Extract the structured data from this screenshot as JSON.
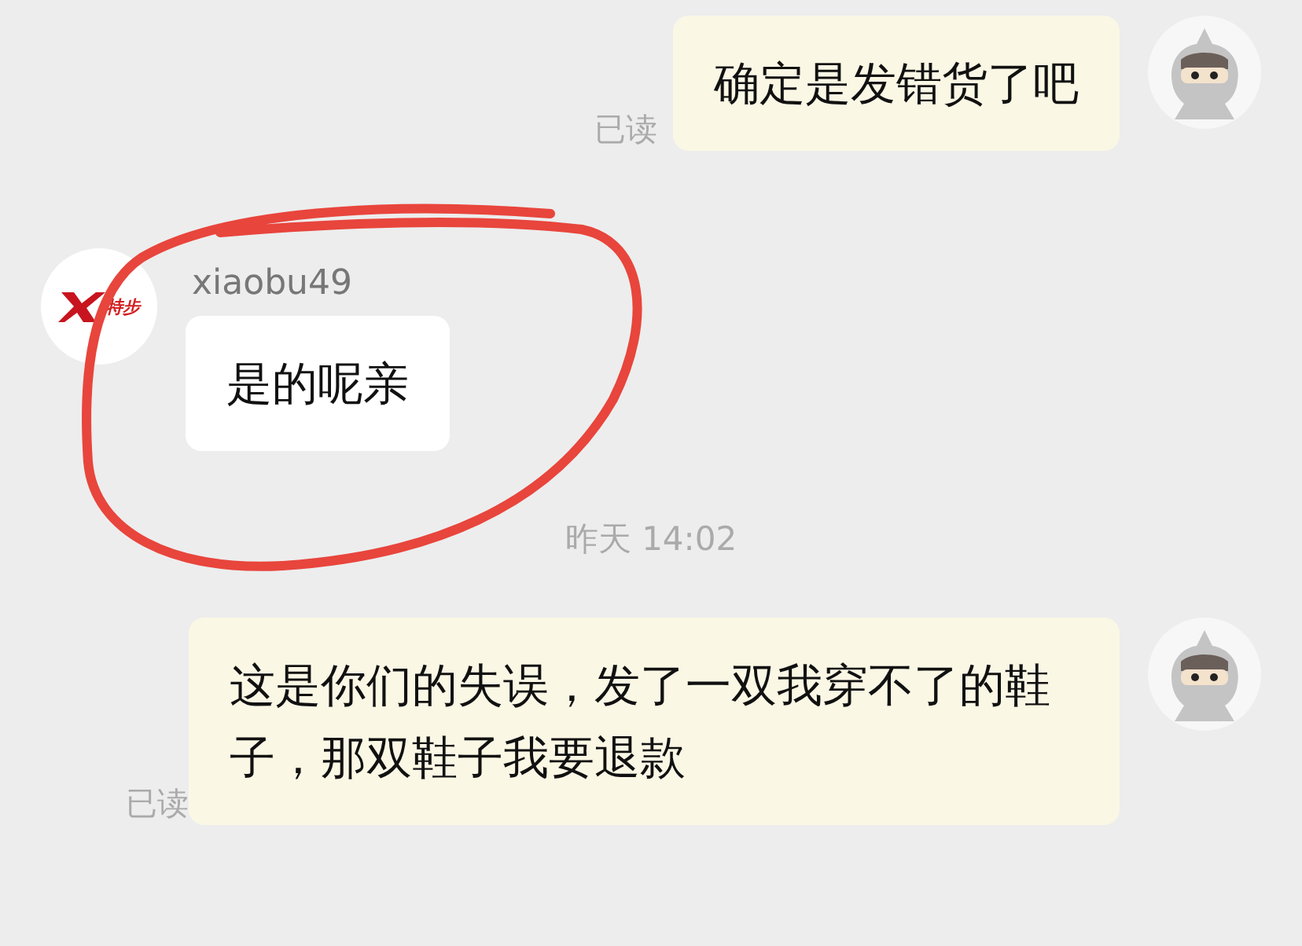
{
  "messages": [
    {
      "kind": "outgoing",
      "text": "确定是发错货了吧",
      "status": "已读"
    },
    {
      "kind": "incoming",
      "sender": "xiaobu49",
      "logo_text": "特步",
      "text": "是的呢亲"
    },
    {
      "kind": "time",
      "text": "昨天 14:02"
    },
    {
      "kind": "outgoing",
      "text": "这是你们的失误，发了一双我穿不了的鞋子，那双鞋子我要退款",
      "status": "已读"
    }
  ],
  "annotation": {
    "kind": "circle",
    "color": "#e8453c"
  }
}
